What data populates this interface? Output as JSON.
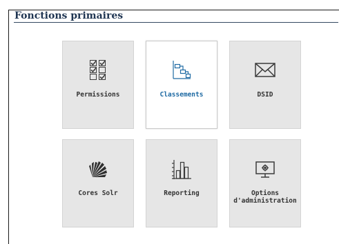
{
  "section": {
    "title": "Fonctions primaires"
  },
  "colors": {
    "accent": "#1e6aa3",
    "title": "#1f3552",
    "tile_bg": "#e6e6e6",
    "icon": "#3a3a3a"
  },
  "tiles": [
    {
      "label": "Permissions",
      "icon": "checklist-icon",
      "active": false
    },
    {
      "label": "Classements",
      "icon": "hierarchy-icon",
      "active": true
    },
    {
      "label": "DSID",
      "icon": "envelope-icon",
      "active": false
    },
    {
      "label": "Cores Solr",
      "icon": "solr-sunburst-icon",
      "active": false
    },
    {
      "label": "Reporting",
      "icon": "bar-chart-icon",
      "active": false
    },
    {
      "label": "Options\nd'administration",
      "icon": "monitor-gear-icon",
      "active": false
    }
  ]
}
